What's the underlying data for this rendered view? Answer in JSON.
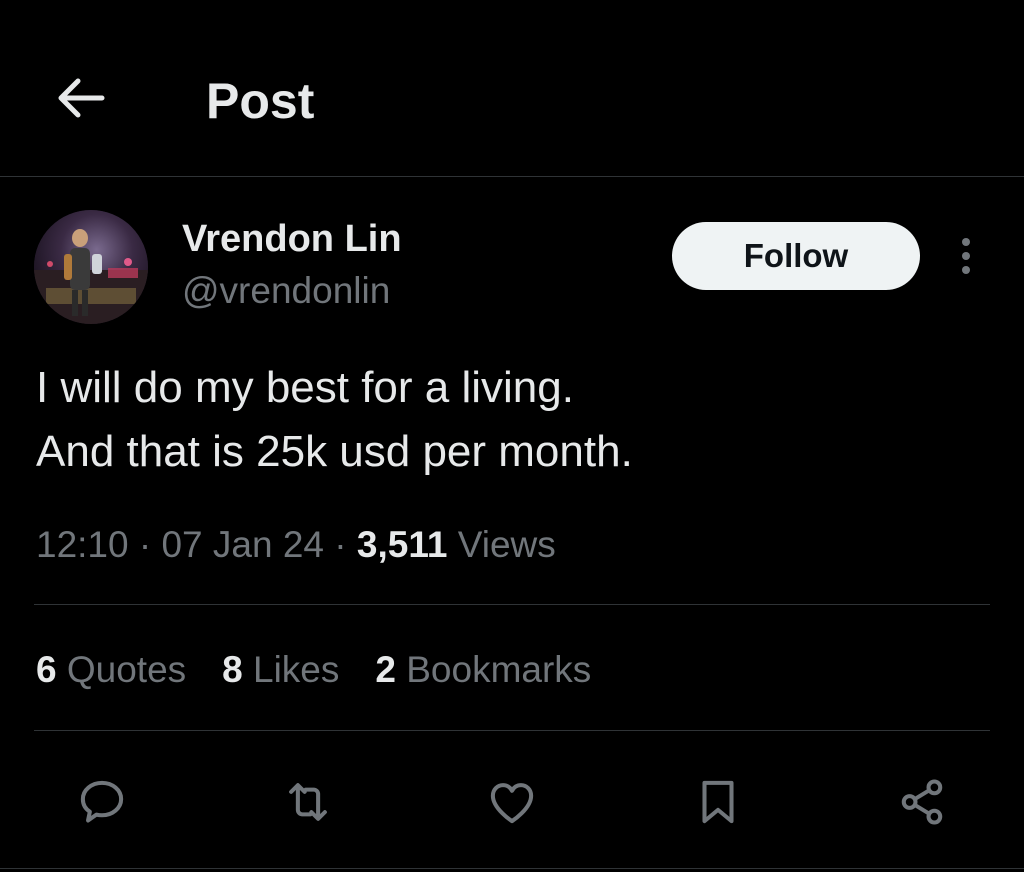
{
  "header": {
    "title": "Post",
    "back_icon": "arrow-left-icon"
  },
  "author": {
    "display_name": "Vrendon Lin",
    "handle": "@vrendonlin",
    "avatar_icon": "avatar-photo",
    "follow_label": "Follow",
    "more_icon": "more-vertical-icon"
  },
  "tweet": {
    "lines": [
      "I will do my best for a living.",
      "And that is 25k usd per month."
    ]
  },
  "meta": {
    "time": "12:10",
    "separator": " · ",
    "date": "07 Jan 24",
    "views_count": "3,511",
    "views_label": " Views"
  },
  "stats": {
    "quotes_count": "6",
    "quotes_label": " Quotes",
    "likes_count": "8",
    "likes_label": " Likes",
    "bookmarks_count": "2",
    "bookmarks_label": " Bookmarks"
  },
  "actions": {
    "reply_icon": "reply-icon",
    "repost_icon": "repost-icon",
    "like_icon": "heart-icon",
    "bookmark_icon": "bookmark-icon",
    "share_icon": "share-icon"
  },
  "colors": {
    "background": "#000000",
    "text_primary": "#e7e9ea",
    "text_secondary": "#71767b",
    "divider": "#2f3336",
    "follow_bg": "#eff3f4",
    "follow_text": "#0f1419"
  }
}
